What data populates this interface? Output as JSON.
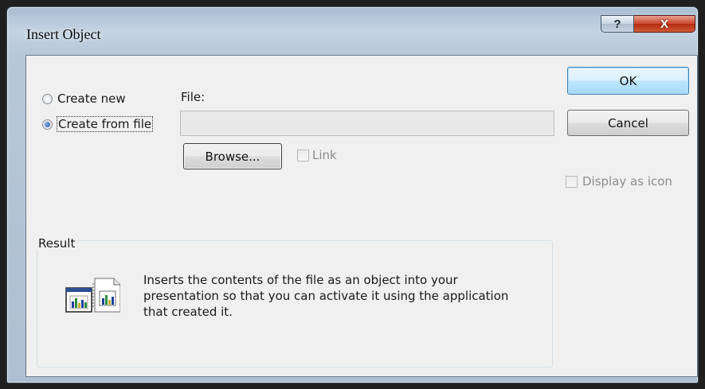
{
  "window": {
    "title": "Insert Object",
    "help_glyph": "?",
    "close_glyph": "X"
  },
  "source": {
    "create_new_label": "Create new",
    "create_from_file_label": "Create from file",
    "selected": "Create from file"
  },
  "file": {
    "label": "File:",
    "value": "",
    "browse_label": "Browse...",
    "link_label": "Link",
    "link_checked": false
  },
  "buttons": {
    "ok_label": "OK",
    "cancel_label": "Cancel"
  },
  "display_as_icon": {
    "label": "Display as icon",
    "checked": false,
    "enabled": false
  },
  "result": {
    "title": "Result",
    "text": "Inserts the contents of the file as an object into your presentation so that you can activate it using the application that created it."
  },
  "icons": {
    "help": "question-mark-icon",
    "close": "close-x-icon",
    "result": "insert-file-object-icon"
  },
  "colors": {
    "accent": "#3c7fb1",
    "close_button": "#c9452b",
    "window_frame": "#b7c8d9",
    "dialog_background": "#f0f0f0",
    "disabled_text": "#8d8d8d"
  }
}
